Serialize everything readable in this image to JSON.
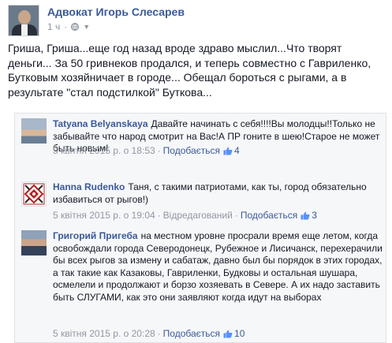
{
  "post": {
    "author": "Адвокат Игорь Слесарев",
    "time": "1 ч",
    "text": "Гриша, Гриша...еще год назад вроде здраво мыслил...Что творят деньги... За 50 гривнеков продался, и теперь совместно с Гавриленко, Бутковым хозяйничает в городе... Обещал бороться с рыгами, а в результате \"стал подстилкой\" Буткова..."
  },
  "comments": [
    {
      "author": "Tatyana Belyanskaya",
      "text": "Давайте начинать с себя!!!!Вы молодцы!!Только не забывайте что народ смотрит на Вас!А ПР гоните в шею!Старое не может быть новым!",
      "time": "5 квітня 2015 р. о 18:53",
      "like_label": "Подобається",
      "likes": "4",
      "edited": ""
    },
    {
      "author": "Hanna Rudenko",
      "text": "Таня, с такими патриотами, как ты, город обязательно избавиться от рыгов!)",
      "time": "5 квітня 2015 р. о 19:04",
      "edited": "Відредагований",
      "like_label": "Подобається",
      "likes": "3"
    },
    {
      "author": "Григорий Пригеба",
      "text": "на местном уровне просрали время еще летом, когда освобождали города Северодонецк, Рубежное и Лисичанск, перехерачили бы всех рыгов за измену и сабатаж, давно был бы порядок в этих городах, а так такие как Казаковы, Гавриленки, Будковы и остальная шушара, осмелели и продолжают и борзо хозяевать в Севере. А их надо заставить быть СЛУГАМИ, как это они заявляют когда идут на выборах",
      "time": "5 квітня 2015 р. о 20:28",
      "like_label": "Подобається",
      "likes": "10",
      "edited": ""
    }
  ],
  "colors": {
    "link": "#3b5998",
    "meta": "#9197a3",
    "comments_bg": "#f6f7f9"
  },
  "icons": [
    "globe-icon",
    "chevron-down-icon",
    "thumbs-up-icon"
  ]
}
